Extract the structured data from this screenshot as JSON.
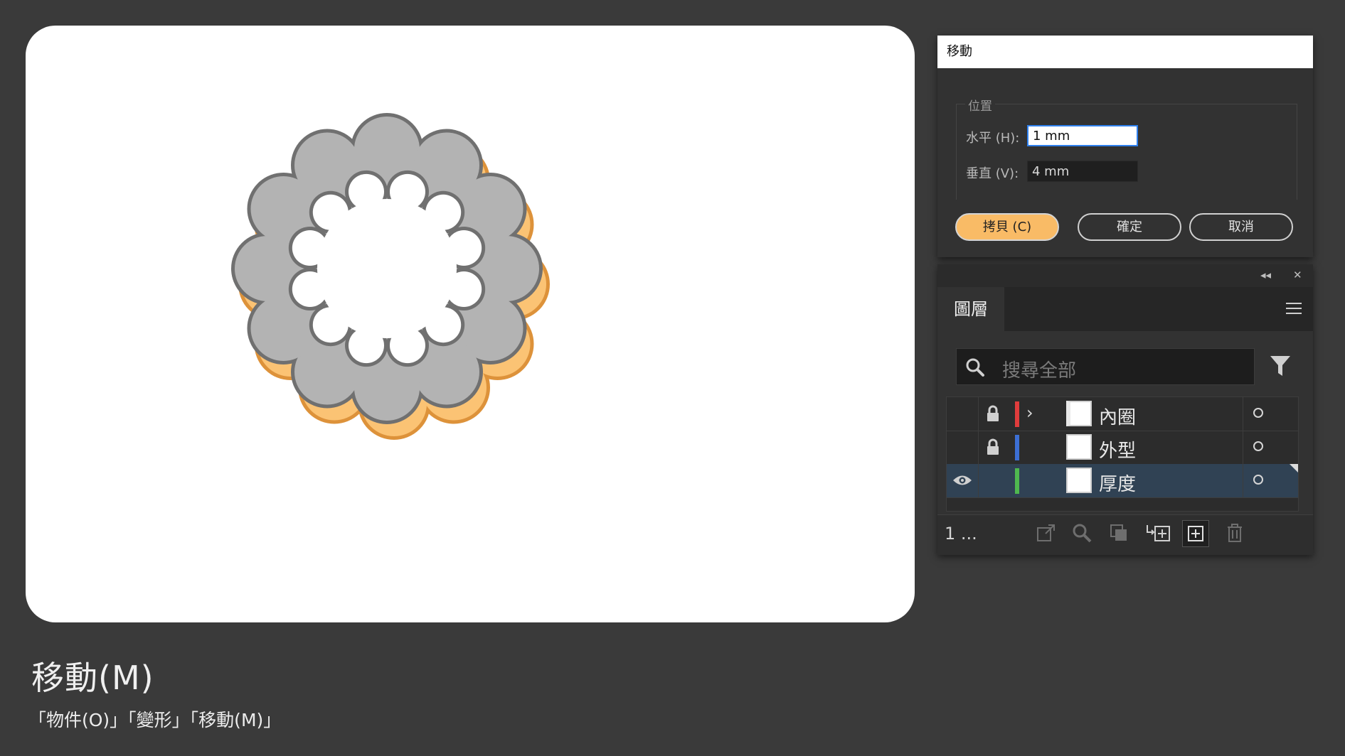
{
  "caption": {
    "title": "移動(M)",
    "menu_path": "「物件(O)」「變形」「移動(M)」"
  },
  "move_dialog": {
    "title": "移動",
    "position_group": "位置",
    "horizontal_label": "水平 (H):",
    "horizontal_value": "1 mm",
    "vertical_label": "垂直 (V):",
    "vertical_value": "4 mm",
    "copy_button": "拷貝 (C)",
    "ok_button": "確定",
    "cancel_button": "取消"
  },
  "layers_panel": {
    "tab": "圖層",
    "search_placeholder": "搜尋全部",
    "layers": [
      {
        "name": "內圈",
        "color": "#e03c3c",
        "locked": true,
        "visible": false,
        "expandable": true,
        "selected": false
      },
      {
        "name": "外型",
        "color": "#3c6fd4",
        "locked": true,
        "visible": false,
        "expandable": false,
        "selected": false
      },
      {
        "name": "厚度",
        "color": "#4fb84f",
        "locked": false,
        "visible": true,
        "expandable": false,
        "selected": true
      }
    ],
    "layer_count": "1 ..."
  },
  "artwork": {
    "top_fill": "#b3b3b3",
    "top_stroke": "#707070",
    "shadow_fill": "#fbc374",
    "shadow_stroke": "#dd923a"
  }
}
